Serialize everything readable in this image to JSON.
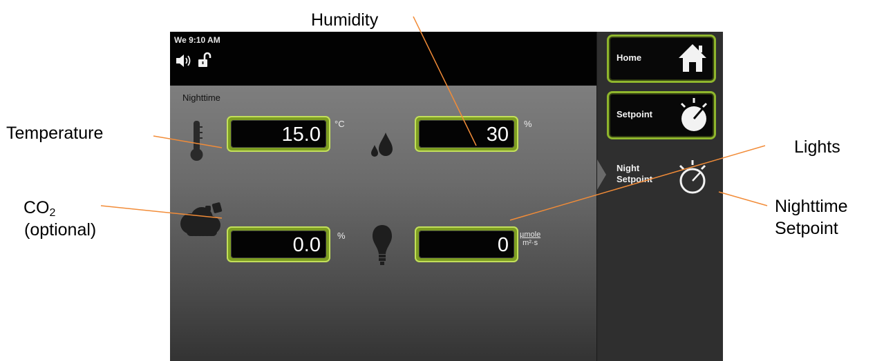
{
  "callouts": {
    "humidity": "Humidity",
    "temperature": "Temperature",
    "co2_main": "CO",
    "co2_sub": "2",
    "co2_note": "(optional)",
    "lights": "Lights",
    "night_line1": "Nighttime",
    "night_line2": "Setpoint"
  },
  "status_bar": {
    "clock": "We  9:10 AM",
    "icons": [
      "speaker-icon",
      "unlocked-padlock-icon"
    ]
  },
  "main": {
    "mode_label": "Nighttime",
    "temperature": {
      "value": "15.0",
      "unit": "°C"
    },
    "humidity": {
      "value": "30",
      "unit": "%"
    },
    "co2": {
      "value": "0.0",
      "unit": "%"
    },
    "light": {
      "value": "0",
      "unit_numerator": "µmole",
      "unit_denominator": "m²·s"
    }
  },
  "sidebar": {
    "home_label": "Home",
    "setpoint_label": "Setpoint",
    "night_setpoint_line1": "Night",
    "night_setpoint_line2": "Setpoint"
  },
  "colors": {
    "arrow": "#f28c38",
    "field_border": "#8fb62d",
    "field_bg": "#040404"
  }
}
